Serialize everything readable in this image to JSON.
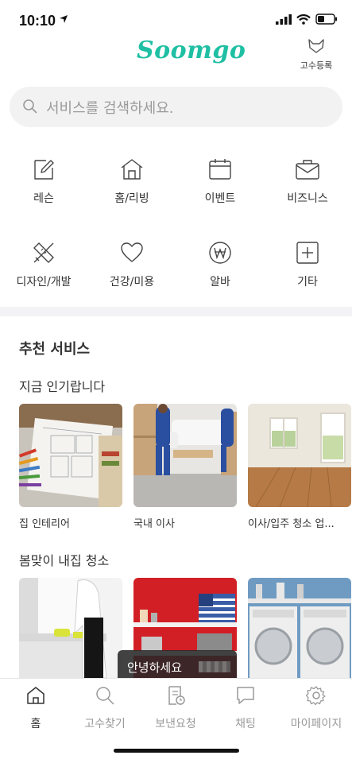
{
  "status": {
    "time": "10:10"
  },
  "header": {
    "logo": "Soomgo",
    "register_label": "고수등록"
  },
  "search": {
    "placeholder": "서비스를 검색하세요."
  },
  "categories": [
    {
      "label": "레슨",
      "icon": "pencil-note-icon"
    },
    {
      "label": "홈/리빙",
      "icon": "house-icon"
    },
    {
      "label": "이벤트",
      "icon": "calendar-icon"
    },
    {
      "label": "비즈니스",
      "icon": "briefcase-icon"
    },
    {
      "label": "디자인/개발",
      "icon": "ruler-pencil-icon"
    },
    {
      "label": "건강/미용",
      "icon": "heart-icon"
    },
    {
      "label": "알바",
      "icon": "won-icon"
    },
    {
      "label": "기타",
      "icon": "plus-box-icon"
    }
  ],
  "recommended": {
    "title": "추천 서비스",
    "popular_title": "지금 인기랍니다",
    "popular": [
      {
        "label": "집 인테리어"
      },
      {
        "label": "국내 이사"
      },
      {
        "label": "이사/입주 청소 업..."
      }
    ],
    "spring_title": "봄맞이 내집 청소"
  },
  "toast": {
    "text": "안녕하세요"
  },
  "tabs": [
    {
      "label": "홈",
      "icon": "home-icon"
    },
    {
      "label": "고수찾기",
      "icon": "search-icon"
    },
    {
      "label": "보낸요청",
      "icon": "request-document-icon"
    },
    {
      "label": "채팅",
      "icon": "chat-bubble-icon"
    },
    {
      "label": "마이페이지",
      "icon": "gear-icon"
    }
  ],
  "colors": {
    "brand": "#1fbfa3",
    "text": "#333333",
    "muted": "#999999",
    "search_bg": "#f2f2f2"
  }
}
